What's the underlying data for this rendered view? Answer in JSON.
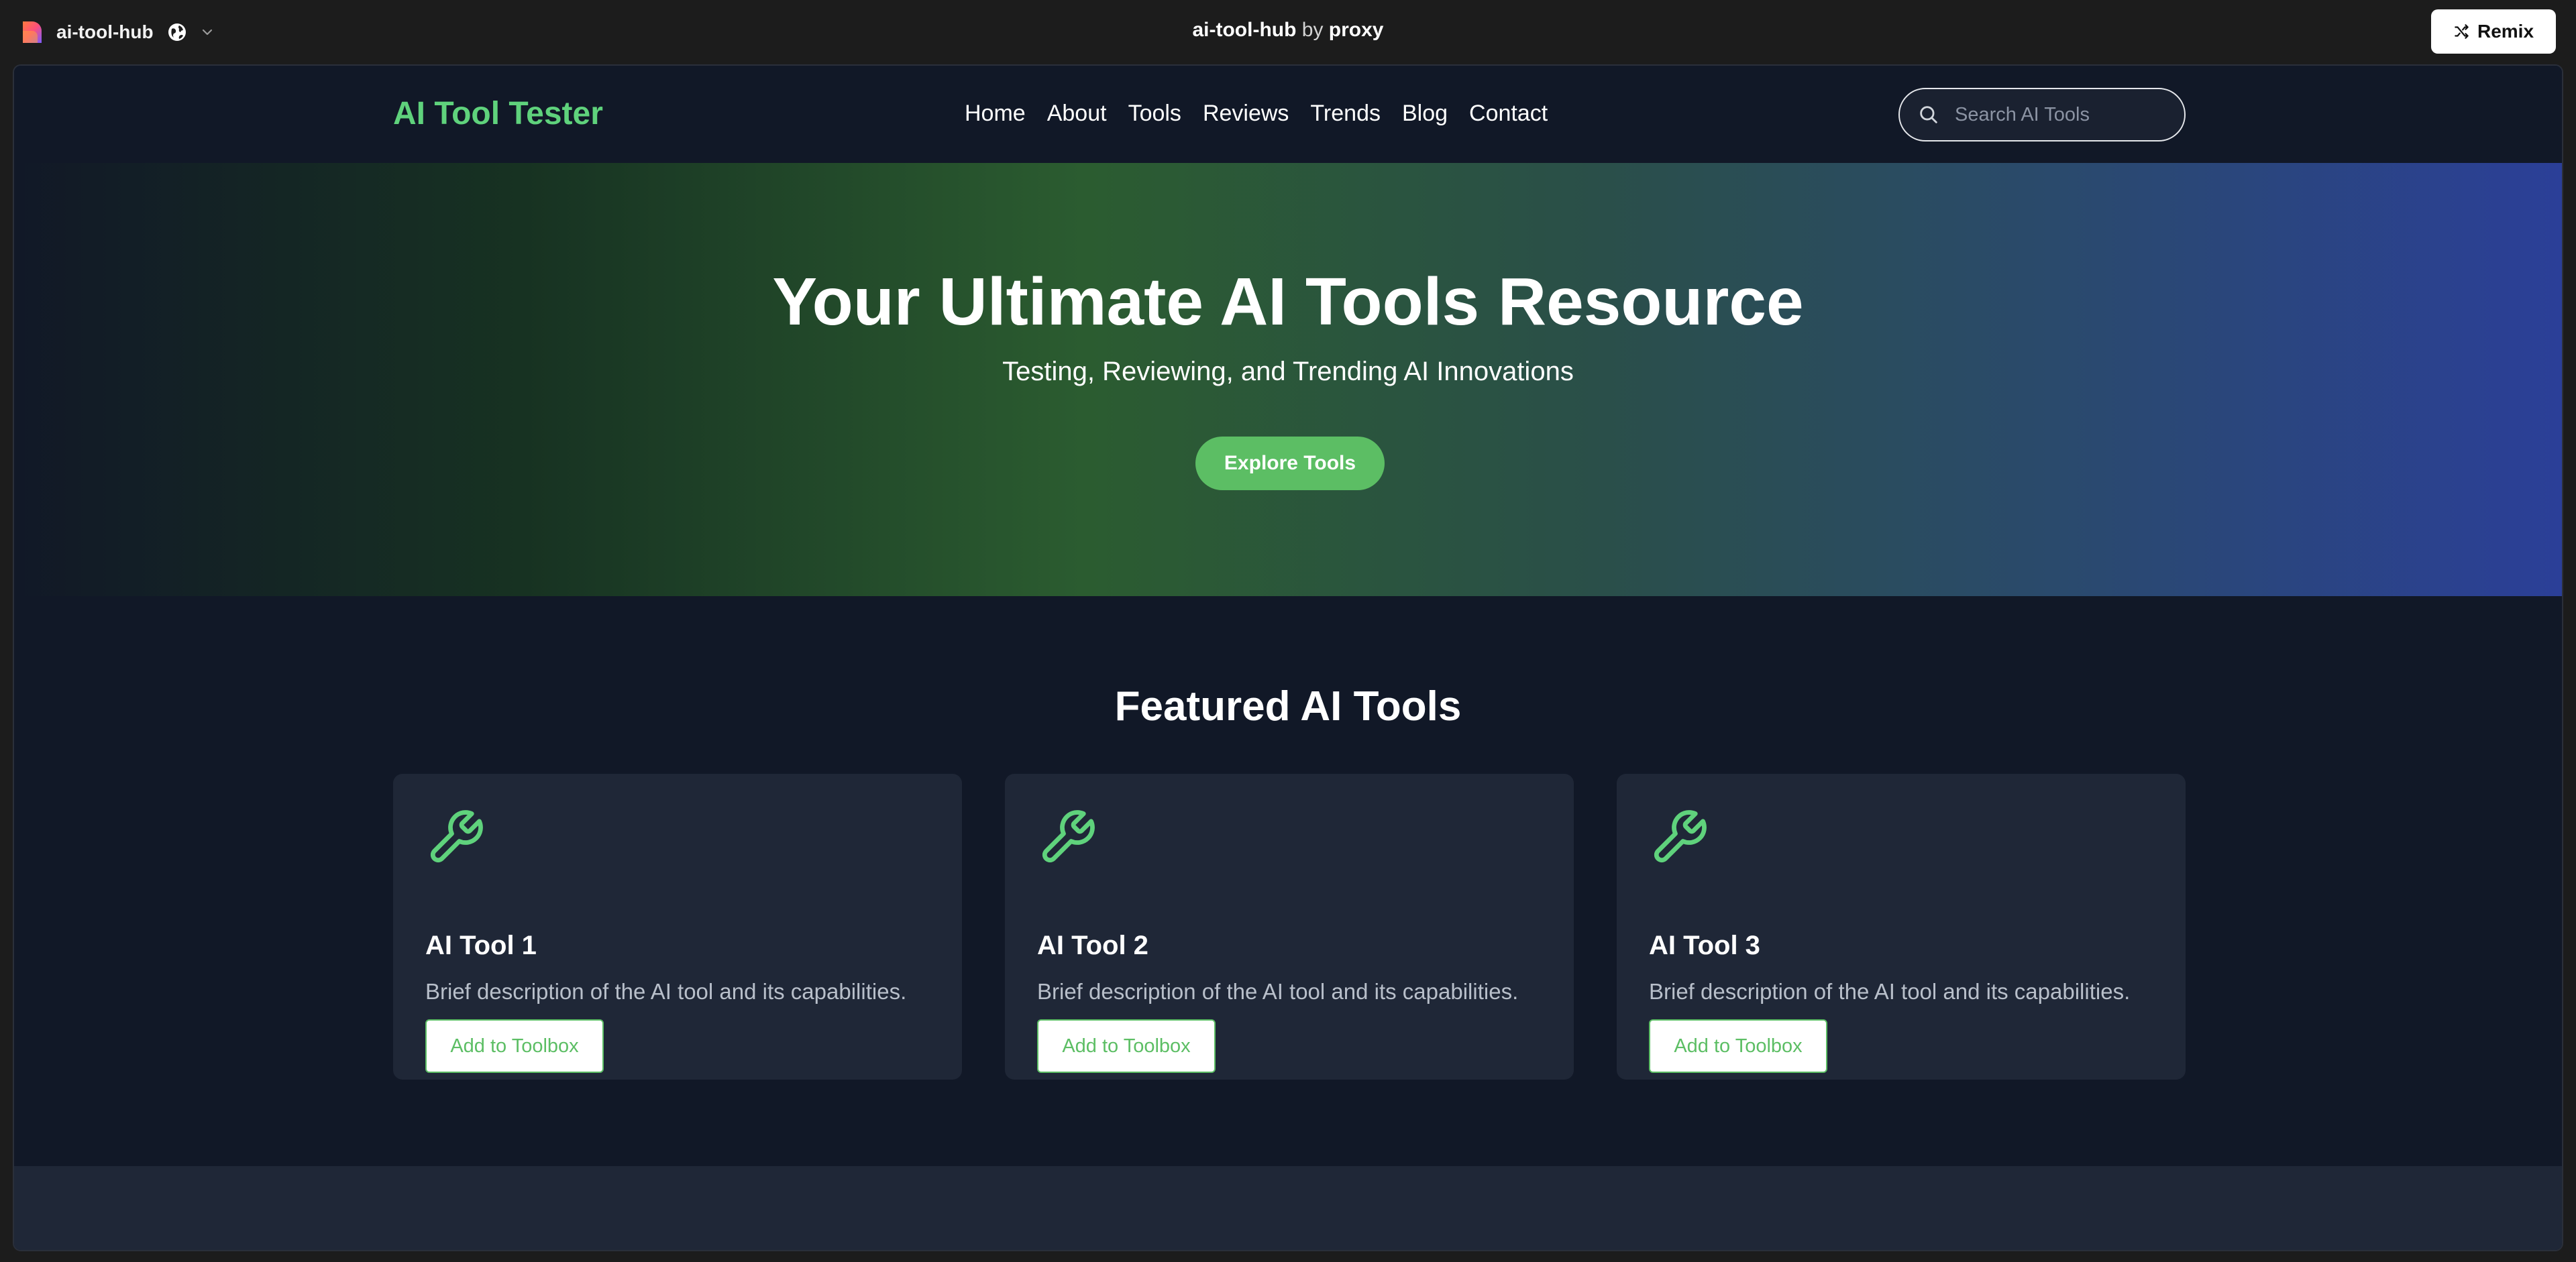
{
  "app": {
    "project_name": "ai-tool-hub",
    "center_title_project": "ai-tool-hub",
    "center_title_by": " by ",
    "center_title_owner": "proxy",
    "remix_label": "Remix",
    "icons": [
      "app-logo-icon",
      "globe-icon",
      "chevron-down-icon",
      "shuffle-icon"
    ]
  },
  "site": {
    "brand": "AI Tool Tester",
    "nav": [
      "Home",
      "About",
      "Tools",
      "Reviews",
      "Trends",
      "Blog",
      "Contact"
    ],
    "search": {
      "placeholder": "Search AI Tools",
      "value": ""
    }
  },
  "hero": {
    "title": "Your Ultimate AI Tools Resource",
    "subtitle": "Testing, Reviewing, and Trending AI Innovations",
    "cta": "Explore Tools"
  },
  "featured": {
    "title": "Featured AI Tools",
    "cards": [
      {
        "title": "AI Tool 1",
        "description": "Brief description of the AI tool and its capabilities.",
        "button": "Add to Toolbox",
        "icon": "wrench-icon"
      },
      {
        "title": "AI Tool 2",
        "description": "Brief description of the AI tool and its capabilities.",
        "button": "Add to Toolbox",
        "icon": "wrench-icon"
      },
      {
        "title": "AI Tool 3",
        "description": "Brief description of the AI tool and its capabilities.",
        "button": "Add to Toolbox",
        "icon": "wrench-icon"
      }
    ]
  },
  "colors": {
    "brand_green": "#5fd27c",
    "button_green": "#5cbe64",
    "page_bg": "#111827",
    "card_bg": "#1f2737",
    "hero_gradient_end": "#2b3f98"
  }
}
